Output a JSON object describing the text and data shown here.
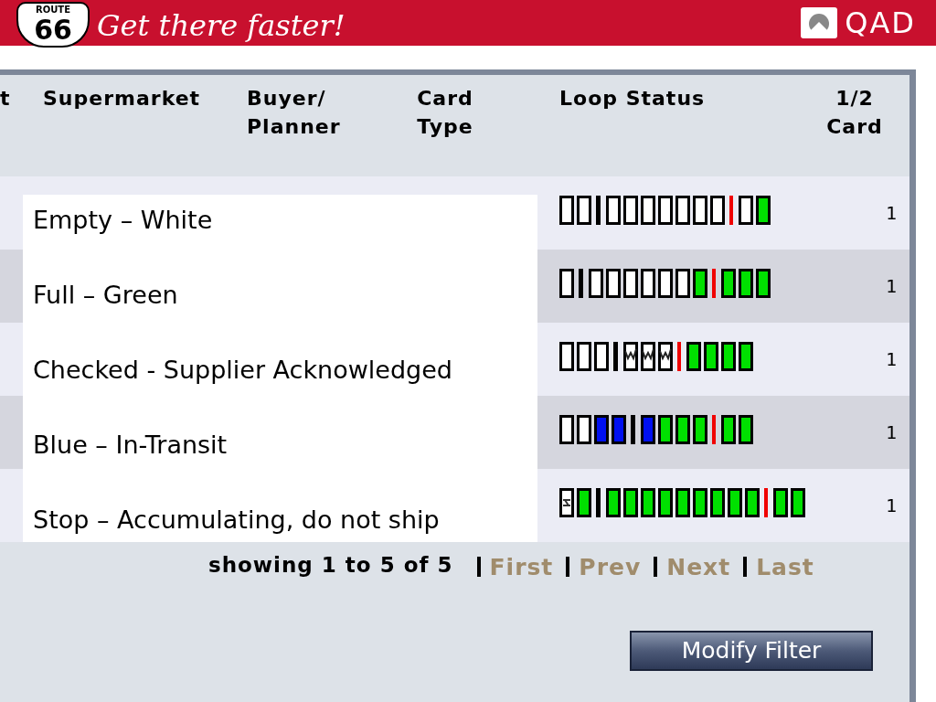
{
  "banner": {
    "shield_top": "ROUTE",
    "shield_number": "66",
    "slogan": "Get there faster!",
    "brand": "QAD"
  },
  "table": {
    "columns": [
      {
        "label": "t"
      },
      {
        "label": "Supermarket"
      },
      {
        "label": "Buyer/ Planner"
      },
      {
        "label": "Card Type"
      },
      {
        "label": "Loop Status"
      },
      {
        "label": "1/2 Card"
      }
    ],
    "rows": [
      {
        "cards": [
          {
            "kind": "empty"
          },
          {
            "kind": "empty"
          },
          {
            "kind": "divider"
          },
          {
            "kind": "empty"
          },
          {
            "kind": "empty"
          },
          {
            "kind": "empty"
          },
          {
            "kind": "empty"
          },
          {
            "kind": "empty"
          },
          {
            "kind": "empty"
          },
          {
            "kind": "empty"
          },
          {
            "kind": "marker"
          },
          {
            "kind": "empty"
          },
          {
            "kind": "full"
          }
        ],
        "half_card": "1"
      },
      {
        "cards": [
          {
            "kind": "empty"
          },
          {
            "kind": "divider"
          },
          {
            "kind": "empty"
          },
          {
            "kind": "empty"
          },
          {
            "kind": "empty"
          },
          {
            "kind": "empty"
          },
          {
            "kind": "empty"
          },
          {
            "kind": "empty"
          },
          {
            "kind": "full"
          },
          {
            "kind": "marker"
          },
          {
            "kind": "full"
          },
          {
            "kind": "full"
          },
          {
            "kind": "full"
          }
        ],
        "half_card": "1"
      },
      {
        "cards": [
          {
            "kind": "empty"
          },
          {
            "kind": "empty"
          },
          {
            "kind": "empty"
          },
          {
            "kind": "divider"
          },
          {
            "kind": "checked"
          },
          {
            "kind": "checked"
          },
          {
            "kind": "checked"
          },
          {
            "kind": "marker"
          },
          {
            "kind": "full"
          },
          {
            "kind": "full"
          },
          {
            "kind": "full"
          },
          {
            "kind": "full"
          }
        ],
        "half_card": "1"
      },
      {
        "cards": [
          {
            "kind": "empty"
          },
          {
            "kind": "empty"
          },
          {
            "kind": "transit"
          },
          {
            "kind": "transit"
          },
          {
            "kind": "divider"
          },
          {
            "kind": "transit"
          },
          {
            "kind": "full"
          },
          {
            "kind": "full"
          },
          {
            "kind": "full"
          },
          {
            "kind": "marker"
          },
          {
            "kind": "full"
          },
          {
            "kind": "full"
          }
        ],
        "half_card": "1"
      },
      {
        "cards": [
          {
            "kind": "stop"
          },
          {
            "kind": "full"
          },
          {
            "kind": "divider"
          },
          {
            "kind": "full"
          },
          {
            "kind": "full"
          },
          {
            "kind": "full"
          },
          {
            "kind": "full"
          },
          {
            "kind": "full"
          },
          {
            "kind": "full"
          },
          {
            "kind": "full"
          },
          {
            "kind": "full"
          },
          {
            "kind": "full"
          },
          {
            "kind": "marker"
          },
          {
            "kind": "full"
          },
          {
            "kind": "full"
          }
        ],
        "half_card": "1"
      }
    ]
  },
  "legend": [
    "Empty – White",
    "Full – Green",
    "Checked - Supplier Acknowledged",
    "Blue – In-Transit",
    "Stop – Accumulating, do not ship"
  ],
  "pagination": {
    "summary": "showing 1 to 5 of 5",
    "links": [
      {
        "label": "First"
      },
      {
        "label": "Prev"
      },
      {
        "label": "Next"
      },
      {
        "label": "Last"
      }
    ]
  },
  "button": "Modify Filter"
}
